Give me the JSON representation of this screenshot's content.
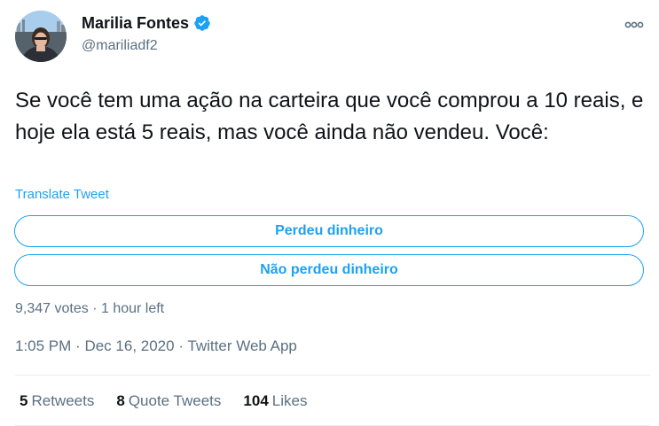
{
  "author": {
    "display_name": "Marilia Fontes",
    "handle": "@mariliadf2",
    "verified": true
  },
  "tweet": {
    "text": "Se você tem uma ação na carteira que você comprou a 10 reais, e hoje ela está 5 reais, mas você ainda não vendeu. Você:",
    "translate_label": "Translate Tweet"
  },
  "poll": {
    "options": [
      "Perdeu dinheiro",
      "Não perdeu dinheiro"
    ],
    "votes_text": "9,347 votes",
    "separator": "·",
    "time_left": "1 hour left"
  },
  "meta": {
    "time": "1:05 PM",
    "separator": "·",
    "date": "Dec 16, 2020",
    "source": "Twitter Web App"
  },
  "stats": {
    "retweets_count": "5",
    "retweets_label": "Retweets",
    "quotes_count": "8",
    "quotes_label": "Quote Tweets",
    "likes_count": "104",
    "likes_label": "Likes"
  },
  "icons": {
    "verified": "verified-badge-icon",
    "more": "more-dots-icon"
  },
  "colors": {
    "accent": "#1da1f2",
    "text": "#0f1419",
    "secondary": "#5b7083",
    "divider": "#ebeef0"
  }
}
